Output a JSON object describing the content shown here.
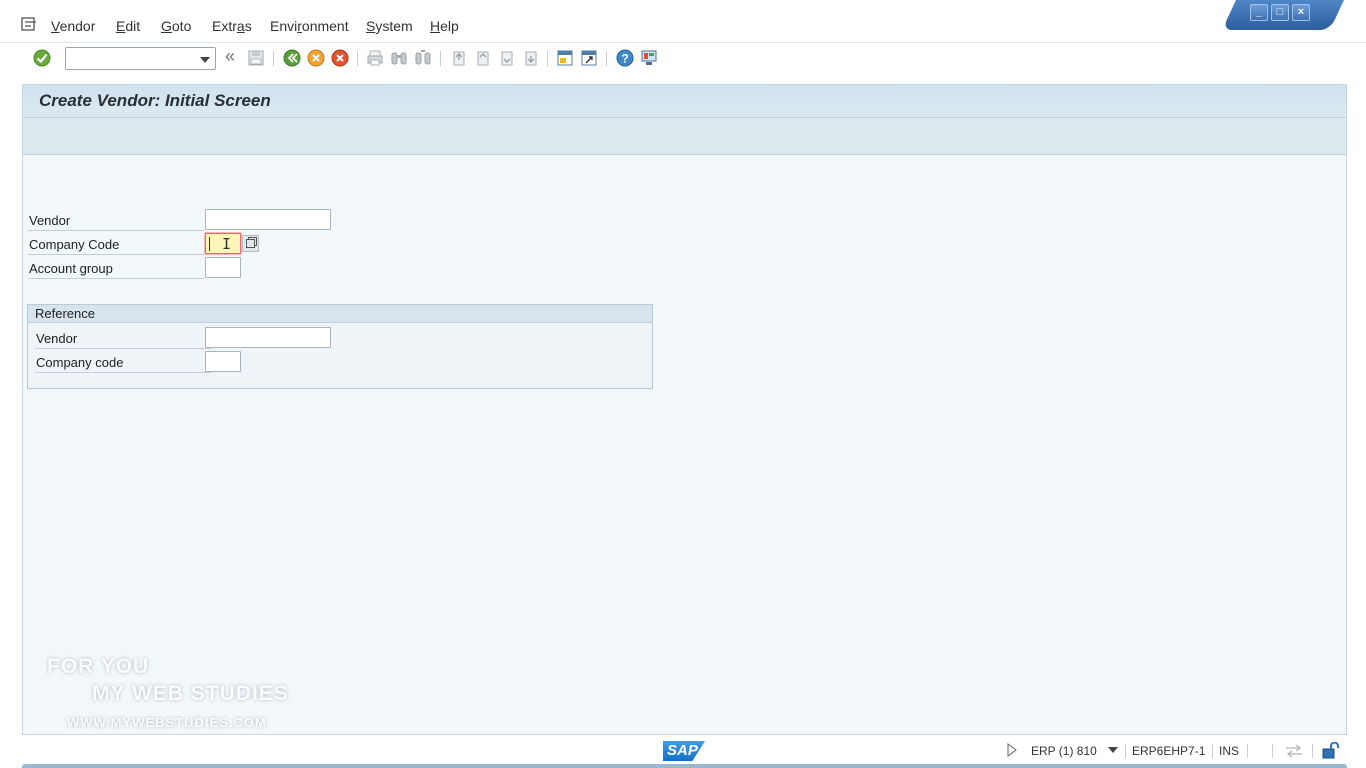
{
  "menubar": {
    "items": [
      {
        "label": "Vendor",
        "key": "V",
        "rest": "endor"
      },
      {
        "label": "Edit",
        "key": "E",
        "rest": "dit"
      },
      {
        "label": "Goto",
        "key": "G",
        "rest": "oto"
      },
      {
        "label": "Extras",
        "pre": "Extr",
        "key": "a",
        "rest": "s"
      },
      {
        "label": "Environment",
        "pre": "Envi",
        "key": "r",
        "rest": "onment"
      },
      {
        "label": "System",
        "key": "S",
        "rest": "ystem"
      },
      {
        "label": "Help",
        "key": "H",
        "rest": "elp"
      }
    ]
  },
  "window_controls": {
    "minimize": "_",
    "maximize": "□",
    "close": "×"
  },
  "toolbar": {
    "command_field_value": "",
    "icons": [
      "enter-check-icon",
      "save-icon",
      "back-icon",
      "exit-icon",
      "cancel-icon",
      "print-icon",
      "find-icon",
      "find-next-icon",
      "first-page-icon",
      "previous-page-icon",
      "next-page-icon",
      "last-page-icon",
      "create-session-icon",
      "shortcut-icon",
      "help-icon",
      "layout-icon"
    ]
  },
  "screen": {
    "title": "Create Vendor:  Initial Screen",
    "fields": {
      "vendor_label": "Vendor",
      "vendor_value": "",
      "company_code_label": "Company Code",
      "company_code_value": "",
      "account_group_label": "Account group",
      "account_group_value": ""
    },
    "reference": {
      "title": "Reference",
      "vendor_label": "Vendor",
      "vendor_value": "",
      "company_code_label": "Company code",
      "company_code_value": ""
    }
  },
  "watermark": {
    "line1": "FOR YOU",
    "line2": "MY WEB STUDIES",
    "line3": "WWW.MYWEBSTUDIES.COM"
  },
  "statusbar": {
    "logo": "SAP",
    "system": "ERP (1) 810",
    "server": "ERP6EHP7-1",
    "mode": "INS"
  }
}
